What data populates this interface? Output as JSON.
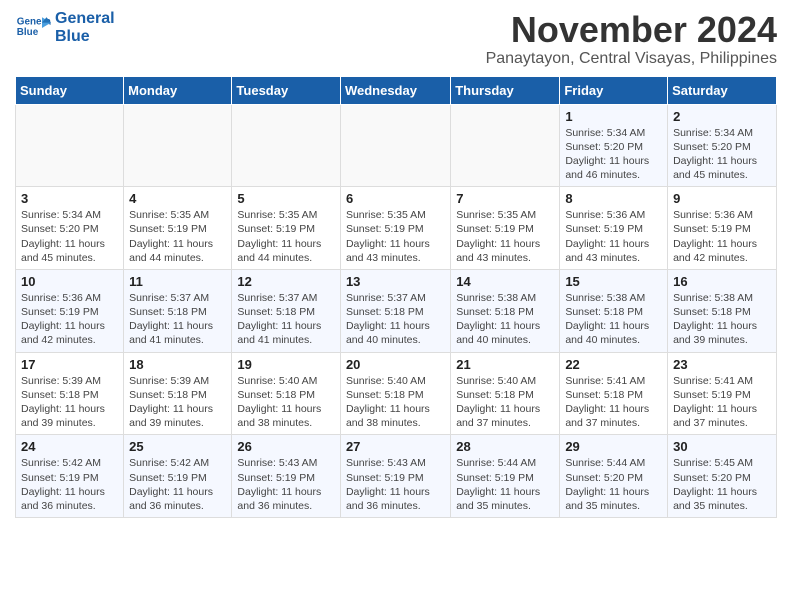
{
  "logo": {
    "line1": "General",
    "line2": "Blue"
  },
  "title": "November 2024",
  "location": "Panaytayon, Central Visayas, Philippines",
  "days_of_week": [
    "Sunday",
    "Monday",
    "Tuesday",
    "Wednesday",
    "Thursday",
    "Friday",
    "Saturday"
  ],
  "weeks": [
    [
      {
        "day": "",
        "info": ""
      },
      {
        "day": "",
        "info": ""
      },
      {
        "day": "",
        "info": ""
      },
      {
        "day": "",
        "info": ""
      },
      {
        "day": "",
        "info": ""
      },
      {
        "day": "1",
        "info": "Sunrise: 5:34 AM\nSunset: 5:20 PM\nDaylight: 11 hours and 46 minutes."
      },
      {
        "day": "2",
        "info": "Sunrise: 5:34 AM\nSunset: 5:20 PM\nDaylight: 11 hours and 45 minutes."
      }
    ],
    [
      {
        "day": "3",
        "info": "Sunrise: 5:34 AM\nSunset: 5:20 PM\nDaylight: 11 hours and 45 minutes."
      },
      {
        "day": "4",
        "info": "Sunrise: 5:35 AM\nSunset: 5:19 PM\nDaylight: 11 hours and 44 minutes."
      },
      {
        "day": "5",
        "info": "Sunrise: 5:35 AM\nSunset: 5:19 PM\nDaylight: 11 hours and 44 minutes."
      },
      {
        "day": "6",
        "info": "Sunrise: 5:35 AM\nSunset: 5:19 PM\nDaylight: 11 hours and 43 minutes."
      },
      {
        "day": "7",
        "info": "Sunrise: 5:35 AM\nSunset: 5:19 PM\nDaylight: 11 hours and 43 minutes."
      },
      {
        "day": "8",
        "info": "Sunrise: 5:36 AM\nSunset: 5:19 PM\nDaylight: 11 hours and 43 minutes."
      },
      {
        "day": "9",
        "info": "Sunrise: 5:36 AM\nSunset: 5:19 PM\nDaylight: 11 hours and 42 minutes."
      }
    ],
    [
      {
        "day": "10",
        "info": "Sunrise: 5:36 AM\nSunset: 5:19 PM\nDaylight: 11 hours and 42 minutes."
      },
      {
        "day": "11",
        "info": "Sunrise: 5:37 AM\nSunset: 5:18 PM\nDaylight: 11 hours and 41 minutes."
      },
      {
        "day": "12",
        "info": "Sunrise: 5:37 AM\nSunset: 5:18 PM\nDaylight: 11 hours and 41 minutes."
      },
      {
        "day": "13",
        "info": "Sunrise: 5:37 AM\nSunset: 5:18 PM\nDaylight: 11 hours and 40 minutes."
      },
      {
        "day": "14",
        "info": "Sunrise: 5:38 AM\nSunset: 5:18 PM\nDaylight: 11 hours and 40 minutes."
      },
      {
        "day": "15",
        "info": "Sunrise: 5:38 AM\nSunset: 5:18 PM\nDaylight: 11 hours and 40 minutes."
      },
      {
        "day": "16",
        "info": "Sunrise: 5:38 AM\nSunset: 5:18 PM\nDaylight: 11 hours and 39 minutes."
      }
    ],
    [
      {
        "day": "17",
        "info": "Sunrise: 5:39 AM\nSunset: 5:18 PM\nDaylight: 11 hours and 39 minutes."
      },
      {
        "day": "18",
        "info": "Sunrise: 5:39 AM\nSunset: 5:18 PM\nDaylight: 11 hours and 39 minutes."
      },
      {
        "day": "19",
        "info": "Sunrise: 5:40 AM\nSunset: 5:18 PM\nDaylight: 11 hours and 38 minutes."
      },
      {
        "day": "20",
        "info": "Sunrise: 5:40 AM\nSunset: 5:18 PM\nDaylight: 11 hours and 38 minutes."
      },
      {
        "day": "21",
        "info": "Sunrise: 5:40 AM\nSunset: 5:18 PM\nDaylight: 11 hours and 37 minutes."
      },
      {
        "day": "22",
        "info": "Sunrise: 5:41 AM\nSunset: 5:18 PM\nDaylight: 11 hours and 37 minutes."
      },
      {
        "day": "23",
        "info": "Sunrise: 5:41 AM\nSunset: 5:19 PM\nDaylight: 11 hours and 37 minutes."
      }
    ],
    [
      {
        "day": "24",
        "info": "Sunrise: 5:42 AM\nSunset: 5:19 PM\nDaylight: 11 hours and 36 minutes."
      },
      {
        "day": "25",
        "info": "Sunrise: 5:42 AM\nSunset: 5:19 PM\nDaylight: 11 hours and 36 minutes."
      },
      {
        "day": "26",
        "info": "Sunrise: 5:43 AM\nSunset: 5:19 PM\nDaylight: 11 hours and 36 minutes."
      },
      {
        "day": "27",
        "info": "Sunrise: 5:43 AM\nSunset: 5:19 PM\nDaylight: 11 hours and 36 minutes."
      },
      {
        "day": "28",
        "info": "Sunrise: 5:44 AM\nSunset: 5:19 PM\nDaylight: 11 hours and 35 minutes."
      },
      {
        "day": "29",
        "info": "Sunrise: 5:44 AM\nSunset: 5:20 PM\nDaylight: 11 hours and 35 minutes."
      },
      {
        "day": "30",
        "info": "Sunrise: 5:45 AM\nSunset: 5:20 PM\nDaylight: 11 hours and 35 minutes."
      }
    ]
  ]
}
